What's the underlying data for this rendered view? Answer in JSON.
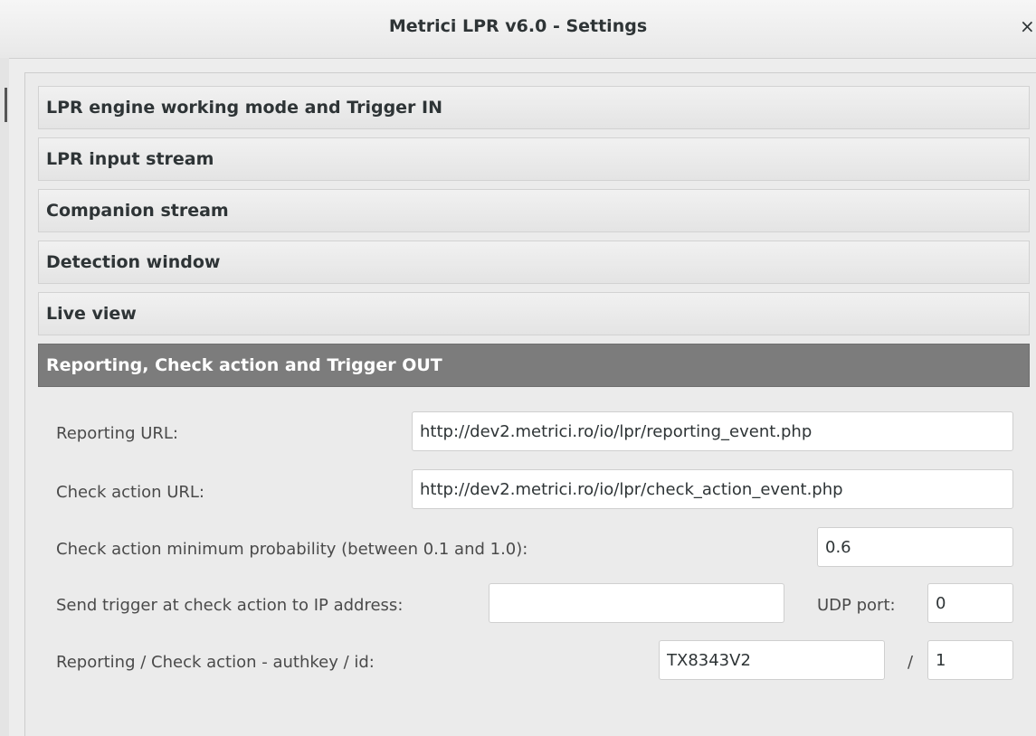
{
  "window": {
    "title": "Metrici LPR v6.0 - Settings",
    "close_glyph": "×"
  },
  "sections": [
    {
      "label": "LPR engine working mode and Trigger IN",
      "active": false
    },
    {
      "label": "LPR input stream",
      "active": false
    },
    {
      "label": "Companion stream",
      "active": false
    },
    {
      "label": "Detection window",
      "active": false
    },
    {
      "label": "Live view",
      "active": false
    },
    {
      "label": "Reporting, Check action and Trigger OUT",
      "active": true
    }
  ],
  "form": {
    "reporting_url_label": "Reporting URL:",
    "reporting_url_value": "http://dev2.metrici.ro/io/lpr/reporting_event.php",
    "check_action_url_label": "Check action URL:",
    "check_action_url_value": "http://dev2.metrici.ro/io/lpr/check_action_event.php",
    "min_probability_label": "Check action minimum probability (between 0.1 and 1.0):",
    "min_probability_value": "0.6",
    "trigger_ip_label": "Send trigger at check action to IP address:",
    "trigger_ip_value": "",
    "udp_port_label": "UDP port:",
    "udp_port_value": "0",
    "authkey_label": "Reporting / Check action - authkey / id:",
    "authkey_value": "TX8343V2",
    "authkey_separator": "/",
    "id_value": "1"
  }
}
